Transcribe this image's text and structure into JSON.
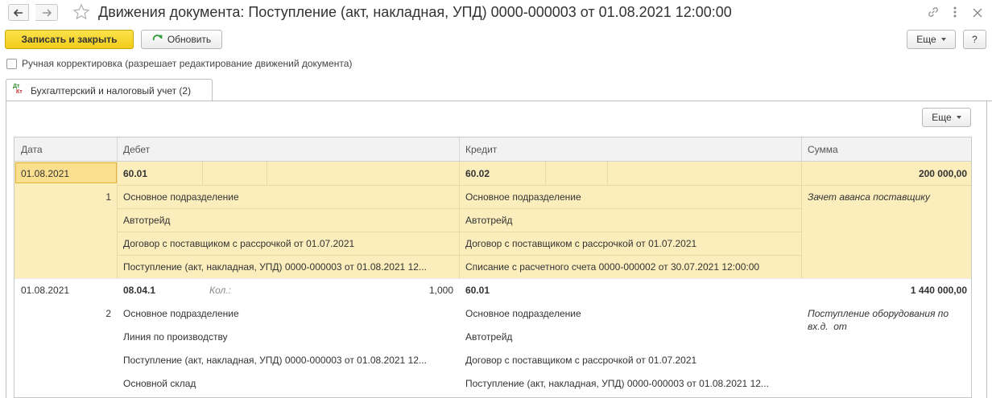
{
  "window": {
    "title": "Движения документа: Поступление (акт, накладная, УПД) 0000-000003 от 01.08.2021 12:00:00",
    "icons": [
      "back-arrow-icon",
      "forward-arrow-icon",
      "star-icon",
      "link-icon",
      "more-vertical-icon",
      "close-icon"
    ]
  },
  "toolbar": {
    "save_close": "Записать и закрыть",
    "refresh": "Обновить",
    "more": "Еще",
    "help": "?"
  },
  "manual_edit": {
    "label": "Ручная корректировка (разрешает редактирование движений документа)",
    "checked": false
  },
  "tab": {
    "label": "Бухгалтерский и налоговый учет (2)",
    "icon": "dt-kt-icon"
  },
  "table": {
    "more": "Еще",
    "headers": [
      "Дата",
      "Дебет",
      "Кредит",
      "Сумма"
    ],
    "records": [
      {
        "date": "01.08.2021",
        "number": "1",
        "debit_account": "60.01",
        "debit_qty_label": "",
        "debit_qty": "",
        "debit_sub": [
          "Основное подразделение",
          "Автотрейд",
          "Договор с поставщиком с рассрочкой от 01.07.2021",
          "Поступление (акт, накладная, УПД) 0000-000003 от 01.08.2021 12..."
        ],
        "credit_account": "60.02",
        "credit_sub": [
          "Основное подразделение",
          "Автотрейд",
          "Договор с поставщиком с рассрочкой от 01.07.2021",
          "Списание с расчетного счета 0000-000002 от 30.07.2021 12:00:00"
        ],
        "amount": "200 000,00",
        "content_line1": "Зачет аванса поставщику",
        "content_line2": ""
      },
      {
        "date": "01.08.2021",
        "number": "2",
        "debit_account": "08.04.1",
        "debit_qty_label": "Кол.:",
        "debit_qty": "1,000",
        "debit_sub": [
          "Основное подразделение",
          "Линия по производству",
          "Поступление (акт, накладная, УПД) 0000-000003 от 01.08.2021 12...",
          "Основной склад"
        ],
        "credit_account": "60.01",
        "credit_sub": [
          "Основное подразделение",
          "Автотрейд",
          "Договор с поставщиком с рассрочкой от 01.07.2021",
          "Поступление (акт, накладная, УПД) 0000-000003 от 01.08.2021 12..."
        ],
        "amount": "1 440 000,00",
        "content_line1": "Поступление оборудования по",
        "content_line2": "вх.д.  от"
      }
    ]
  },
  "colors": {
    "primary_button": "#f5d325",
    "selected_row": "#fbeebc",
    "header_bg": "#f2f2f2",
    "refresh_icon": "#2e9e3a"
  }
}
